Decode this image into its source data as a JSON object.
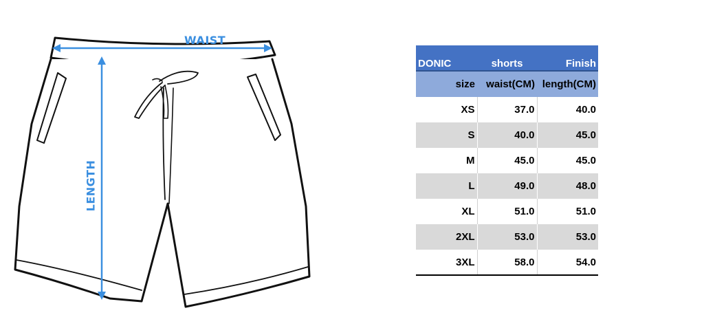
{
  "figure": {
    "waist_label": "WAIST",
    "length_label": "LENGTH",
    "accent_color": "#3b8fe0"
  },
  "table": {
    "title": [
      "DONIC",
      "shorts",
      "Finish"
    ],
    "headers": [
      "size",
      "waist(CM)",
      "length(CM)"
    ],
    "rows": [
      [
        "XS",
        "37.0",
        "40.0"
      ],
      [
        "S",
        "40.0",
        "45.0"
      ],
      [
        "M",
        "45.0",
        "45.0"
      ],
      [
        "L",
        "49.0",
        "48.0"
      ],
      [
        "XL",
        "51.0",
        "51.0"
      ],
      [
        "2XL",
        "53.0",
        "53.0"
      ],
      [
        "3XL",
        "58.0",
        "54.0"
      ]
    ],
    "colors": {
      "title_bg": "#4472c4",
      "header_bg": "#8eaadb",
      "stripe_bg": "#d9d9d9"
    }
  }
}
